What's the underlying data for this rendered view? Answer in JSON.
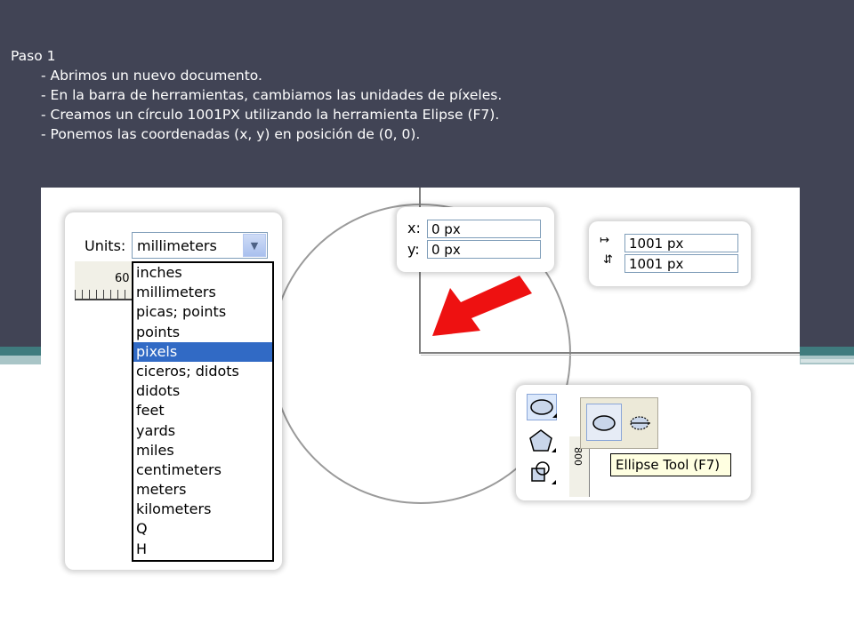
{
  "instructions": {
    "title": "Paso 1",
    "steps": [
      "- Abrimos un nuevo documento.",
      "- En la barra de herramientas, cambiamos las unidades de píxeles.",
      "- Creamos un círculo 1001PX utilizando la herramienta Elipse (F7).",
      "- Ponemos las coordenadas (x, y) en posición de (0, 0)."
    ]
  },
  "units_panel": {
    "label": "Units:",
    "selected_value": "millimeters",
    "ruler_value": "60",
    "options": [
      "inches",
      "millimeters",
      "picas; points",
      "points",
      "pixels",
      "ciceros; didots",
      "didots",
      "feet",
      "yards",
      "miles",
      "centimeters",
      "meters",
      "kilometers",
      "Q",
      "H"
    ],
    "highlighted_option": "pixels"
  },
  "position_panel": {
    "x_label": "x:",
    "x_value": "0 px",
    "y_label": "y:",
    "y_value": "0 px"
  },
  "size_panel": {
    "width_value": "1001 px",
    "height_value": "1001 px",
    "width_icon": "horizontal-size-icon",
    "height_icon": "vertical-size-icon"
  },
  "toolbox": {
    "mini_ruler_value": "800",
    "tooltip": "Ellipse Tool (F7)",
    "tools": [
      "ellipse-tool-icon",
      "polygon-tool-icon",
      "basic-shapes-tool-icon"
    ],
    "flyout_tools": [
      "ellipse-tool-icon",
      "three-point-ellipse-tool-icon"
    ]
  },
  "colors": {
    "header_bg": "#414455",
    "accent_teal": "#3f7b7e",
    "selection_blue": "#316ac5",
    "arrow_red": "#ee1111",
    "tooltip_bg": "#ffffe1"
  }
}
